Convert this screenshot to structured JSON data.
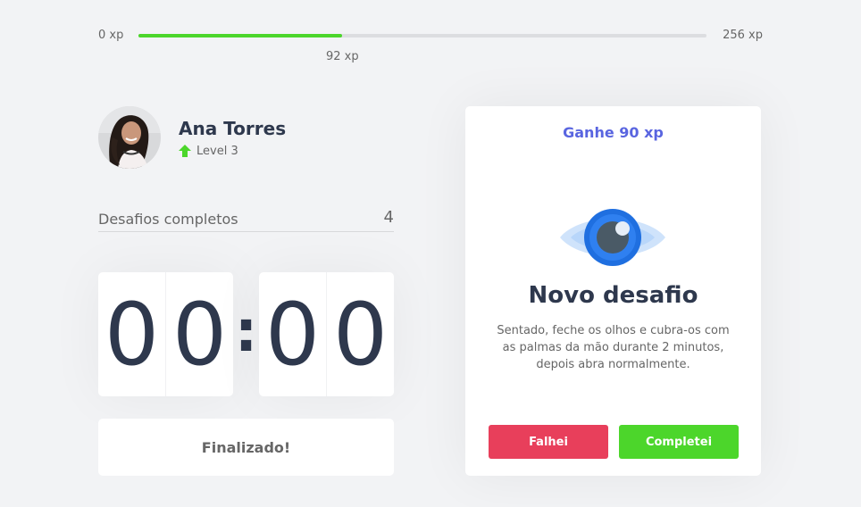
{
  "xp_bar": {
    "min_label": "0 xp",
    "max_label": "256 xp",
    "current_label": "92 xp",
    "progress_fraction": 0.359
  },
  "profile": {
    "name": "Ana Torres",
    "level_label": "Level 3",
    "avatar_icon": "user-avatar-photo",
    "level_icon": "arrow-up-icon"
  },
  "completed": {
    "label": "Desafios completos",
    "count": "4"
  },
  "countdown": {
    "minute_left": "0",
    "minute_right": "0",
    "separator": ":",
    "second_left": "0",
    "second_right": "0"
  },
  "finish_label": "Finalizado!",
  "challenge": {
    "reward": "Ganhe 90 xp",
    "icon": "eye-icon",
    "title": "Novo desafio",
    "description": "Sentado, feche os olhos e cubra-os com as palmas da mão durante 2 minutos, depois abra normalmente.",
    "fail_label": "Falhei",
    "success_label": "Completei"
  },
  "colors": {
    "accent": "#5965e0",
    "success": "#4cd62b",
    "danger": "#e83f5b",
    "title": "#2e384d",
    "text": "#666666",
    "background": "#f2f3f5"
  }
}
